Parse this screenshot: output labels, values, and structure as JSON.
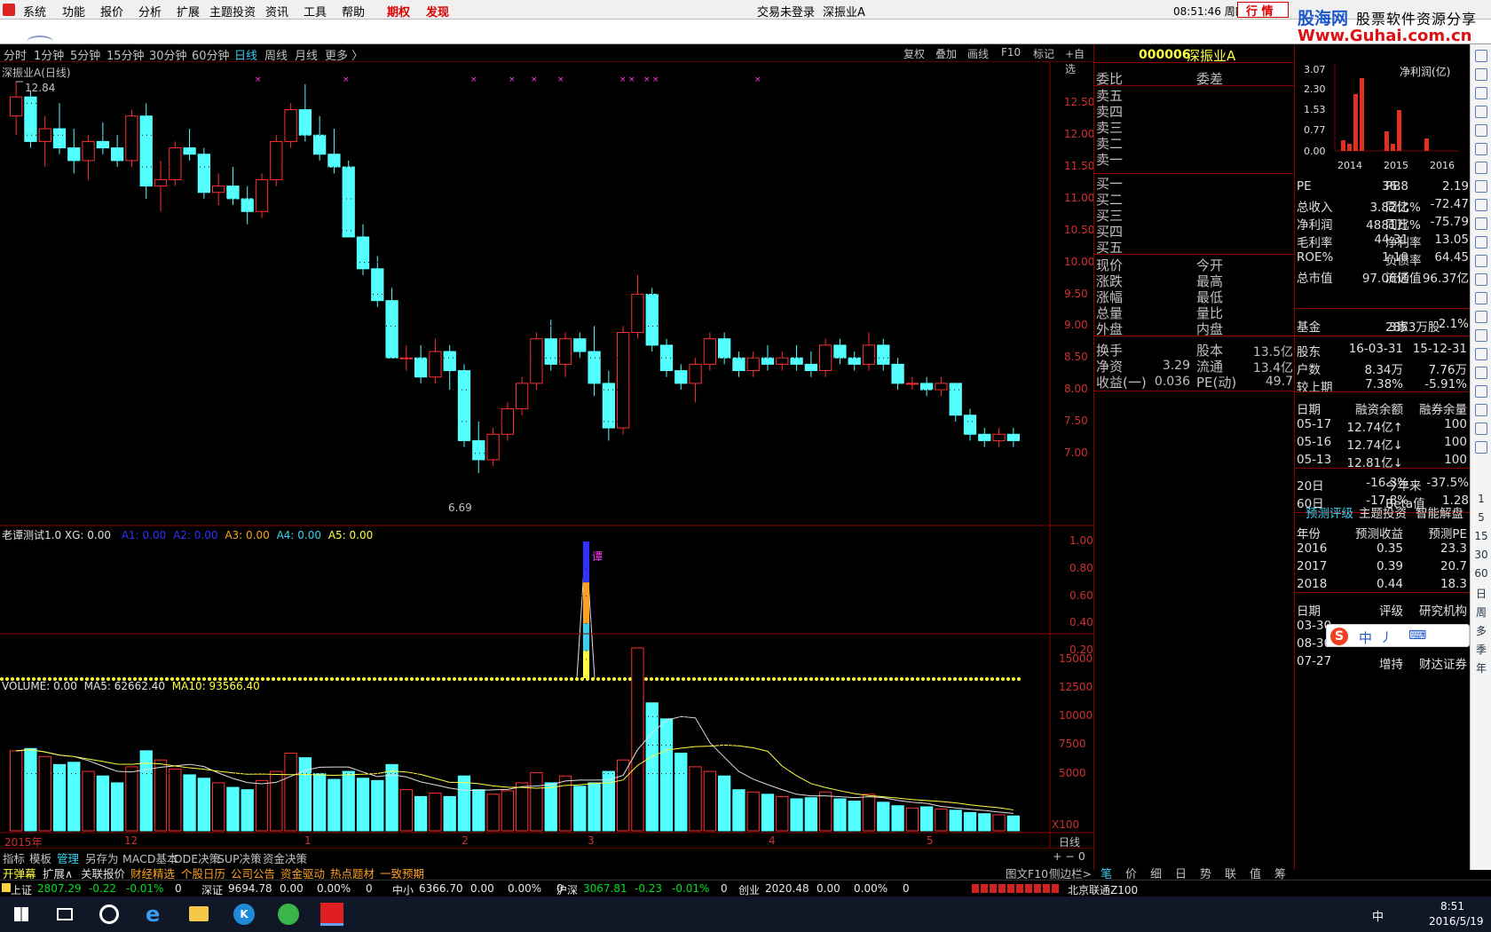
{
  "menu": {
    "items": [
      "系统",
      "功能",
      "报价",
      "分析",
      "扩展",
      "主题投资",
      "资讯",
      "工具",
      "帮助"
    ],
    "options": "期权",
    "discovery": "发现",
    "trade_status": "交易未登录",
    "stock_name": "深振业A",
    "clock": "08:51:46 周四",
    "trade_btn": "行  情"
  },
  "logo": {
    "cn": "股海网",
    "slogan": "股票软件资源分享",
    "url": "Www.Guhai.com.cn"
  },
  "timeframes": [
    "分时",
    "1分钟",
    "5分钟",
    "15分钟",
    "30分钟",
    "60分钟",
    "日线",
    "周线",
    "月线",
    "更多 〉"
  ],
  "chart_tools": [
    "复权",
    "叠加",
    "画线",
    "F10",
    "标记",
    "+自选"
  ],
  "main_chart": {
    "title": "深振业A(日线)",
    "high_label": "12.84",
    "low_label": "6.69",
    "ylabels": [
      "12.50",
      "12.00",
      "11.50",
      "11.00",
      "10.50",
      "10.00",
      "9.50",
      "9.00",
      "8.50",
      "8.00",
      "7.50",
      "7.00"
    ]
  },
  "chart_data": {
    "type": "candlestick",
    "series": [
      {
        "name": "深振业A(日线)",
        "ohlc": [
          [
            12.3,
            12.84,
            12.0,
            12.6
          ],
          [
            12.6,
            12.7,
            11.8,
            11.9
          ],
          [
            11.9,
            12.3,
            11.5,
            12.1
          ],
          [
            12.1,
            12.5,
            11.7,
            11.8
          ],
          [
            11.8,
            12.1,
            11.4,
            11.6
          ],
          [
            11.6,
            12.0,
            11.3,
            11.9
          ],
          [
            11.9,
            12.2,
            11.7,
            11.8
          ],
          [
            11.8,
            12.0,
            11.5,
            11.6
          ],
          [
            11.6,
            12.4,
            11.5,
            12.3
          ],
          [
            12.3,
            12.5,
            11.0,
            11.2
          ],
          [
            11.2,
            11.6,
            10.8,
            11.3
          ],
          [
            11.3,
            11.9,
            11.2,
            11.8
          ],
          [
            11.8,
            12.1,
            11.6,
            11.7
          ],
          [
            11.7,
            11.8,
            11.0,
            11.1
          ],
          [
            11.1,
            11.4,
            10.9,
            11.2
          ],
          [
            11.2,
            11.5,
            10.9,
            11.0
          ],
          [
            11.0,
            11.2,
            10.6,
            10.8
          ],
          [
            10.8,
            11.4,
            10.7,
            11.3
          ],
          [
            11.3,
            12.0,
            11.2,
            11.9
          ],
          [
            11.9,
            12.5,
            11.8,
            12.4
          ],
          [
            12.4,
            12.8,
            11.9,
            12.0
          ],
          [
            12.0,
            12.3,
            11.6,
            11.7
          ],
          [
            11.7,
            12.1,
            11.4,
            11.5
          ],
          [
            11.5,
            11.6,
            10.4,
            10.4
          ],
          [
            10.4,
            10.6,
            9.8,
            9.9
          ],
          [
            9.9,
            10.1,
            9.3,
            9.4
          ],
          [
            9.4,
            9.6,
            8.5,
            8.5
          ],
          [
            8.5,
            8.7,
            8.3,
            8.5
          ],
          [
            8.5,
            8.7,
            8.1,
            8.2
          ],
          [
            8.2,
            8.8,
            8.1,
            8.6
          ],
          [
            8.6,
            8.7,
            8.0,
            8.3
          ],
          [
            8.3,
            8.4,
            7.1,
            7.2
          ],
          [
            7.2,
            7.5,
            6.69,
            6.9
          ],
          [
            6.9,
            7.4,
            6.8,
            7.3
          ],
          [
            7.3,
            7.8,
            7.2,
            7.7
          ],
          [
            7.7,
            8.2,
            7.6,
            8.1
          ],
          [
            8.1,
            8.9,
            8.0,
            8.8
          ],
          [
            8.8,
            9.1,
            8.3,
            8.4
          ],
          [
            8.4,
            8.9,
            8.2,
            8.8
          ],
          [
            8.8,
            8.9,
            8.5,
            8.6
          ],
          [
            8.6,
            9.0,
            7.9,
            8.1
          ],
          [
            8.1,
            8.3,
            7.2,
            7.4
          ],
          [
            7.4,
            9.0,
            7.3,
            8.9
          ],
          [
            8.9,
            9.8,
            8.8,
            9.5
          ],
          [
            9.5,
            9.6,
            8.6,
            8.7
          ],
          [
            8.7,
            8.8,
            8.2,
            8.3
          ],
          [
            8.3,
            8.4,
            8.0,
            8.1
          ],
          [
            8.1,
            8.5,
            7.8,
            8.4
          ],
          [
            8.4,
            8.9,
            8.3,
            8.8
          ],
          [
            8.8,
            8.9,
            8.4,
            8.5
          ],
          [
            8.5,
            8.6,
            8.2,
            8.3
          ],
          [
            8.3,
            8.6,
            8.2,
            8.5
          ],
          [
            8.5,
            8.7,
            8.3,
            8.4
          ],
          [
            8.4,
            8.6,
            8.3,
            8.5
          ],
          [
            8.5,
            8.7,
            8.3,
            8.4
          ],
          [
            8.4,
            8.6,
            8.2,
            8.3
          ],
          [
            8.3,
            8.8,
            8.2,
            8.7
          ],
          [
            8.7,
            8.8,
            8.4,
            8.5
          ],
          [
            8.5,
            8.6,
            8.3,
            8.4
          ],
          [
            8.4,
            8.9,
            8.3,
            8.7
          ],
          [
            8.7,
            8.8,
            8.3,
            8.4
          ],
          [
            8.4,
            8.5,
            8.0,
            8.1
          ],
          [
            8.1,
            8.2,
            8.0,
            8.1
          ],
          [
            8.1,
            8.2,
            7.9,
            8.0
          ],
          [
            8.0,
            8.2,
            7.9,
            8.1
          ],
          [
            8.1,
            8.1,
            7.5,
            7.6
          ],
          [
            7.6,
            7.7,
            7.2,
            7.3
          ],
          [
            7.3,
            7.4,
            7.1,
            7.2
          ],
          [
            7.2,
            7.4,
            7.1,
            7.3
          ],
          [
            7.3,
            7.4,
            7.1,
            7.2
          ]
        ]
      }
    ]
  },
  "ind1": {
    "title": "老谭测试1.0 XG: 0.00",
    "a1": "A1: 0.00",
    "a2": "A2: 0.00",
    "a3": "A3: 0.00",
    "a4": "A4: 0.00",
    "a5": "A5: 0.00",
    "mark": "谭",
    "ylabels": [
      "1.00",
      "0.80",
      "0.60",
      "0.40",
      "0.20"
    ]
  },
  "vol": {
    "title": "VOLUME: 0.00",
    "ma5": "MA5: 62662.40",
    "ma10": "MA10: 93566.40",
    "ylabels": [
      "15000",
      "12500",
      "10000",
      "7500",
      "5000"
    ],
    "unit": "X100"
  },
  "xaxis": {
    "year": "2015年",
    "months": [
      "12",
      "1",
      "2",
      "3",
      "4",
      "5"
    ],
    "period": "日线"
  },
  "order": {
    "code": "000006",
    "name": "深振业A",
    "h1": "委比",
    "h2": "委差",
    "sells": [
      "卖五",
      "卖四",
      "卖三",
      "卖二",
      "卖一"
    ],
    "buys": [
      "买一",
      "买二",
      "买三",
      "买四",
      "买五"
    ],
    "left": [
      "现价",
      "涨跌",
      "涨幅",
      "总量",
      "外盘"
    ],
    "right": [
      "今开",
      "最高",
      "最低",
      "量比",
      "内盘"
    ],
    "turn": "换手",
    "turn_v": "",
    "cap": "股本",
    "cap_v": "13.5亿",
    "na": "净资",
    "na_v": "3.29",
    "flow": "流通",
    "flow_v": "13.4亿",
    "eps": "收益(一)",
    "eps_v": "0.036",
    "pe": "PE(动)",
    "pe_v": "49.7"
  },
  "panel_tabs": [
    "笔",
    "价",
    "细",
    "日",
    "势",
    "联",
    "值",
    "筹"
  ],
  "f10": {
    "chart_label": "净利润(亿)",
    "yvals": [
      "3.07",
      "2.30",
      "1.53",
      "0.77",
      "0.00"
    ],
    "years": [
      "2014",
      "2015",
      "2016"
    ],
    "rows1": [
      [
        "PE",
        "36.8",
        "PB",
        "2.19"
      ],
      [
        "总收入",
        "3.82亿",
        "同比%",
        "-72.47"
      ],
      [
        "净利润",
        "4881万",
        "同比%",
        "-75.79"
      ],
      [
        "毛利率",
        "44.31",
        "净利率",
        "13.05"
      ],
      [
        "ROE%",
        "1.10",
        "负债率",
        "64.45"
      ],
      [
        "总市值",
        "97.06亿",
        "流通值",
        "96.37亿"
      ]
    ],
    "fund": [
      "基金",
      "3家",
      "2853万股",
      "2.1%"
    ],
    "holders": [
      [
        "股东",
        "16-03-31",
        "15-12-31"
      ],
      [
        "户数",
        "8.34万",
        "7.76万"
      ],
      [
        "较上期",
        "7.38%",
        "-5.91%"
      ]
    ],
    "margin_head": [
      "日期",
      "融资余额",
      "融券余量"
    ],
    "margin": [
      [
        "05-17",
        "12.74亿↑",
        "100"
      ],
      [
        "05-16",
        "12.74亿↓",
        "100"
      ],
      [
        "05-13",
        "12.81亿↓",
        "100"
      ]
    ],
    "perf": [
      [
        "20日",
        "-16.3%",
        "今年来",
        "-37.5%"
      ],
      [
        "60日",
        "-17.8%",
        "Beta值",
        "1.28"
      ]
    ],
    "ftabs": [
      "预测评级",
      "主题投资",
      "智能解盘"
    ],
    "fhead": [
      "年份",
      "预测收益",
      "预测PE"
    ],
    "frows": [
      [
        "2016",
        "0.35",
        "23.3"
      ],
      [
        "2017",
        "0.39",
        "20.7"
      ],
      [
        "2018",
        "0.44",
        "18.3"
      ]
    ],
    "rhead": [
      "日期",
      "评级",
      "研究机构"
    ],
    "rrows": [
      [
        "03-30",
        "",
        ""
      ],
      [
        "08-30",
        "",
        ""
      ],
      [
        "07-27",
        "增持",
        "财达证券"
      ]
    ],
    "ime": [
      "中",
      "丿",
      "⌨"
    ]
  },
  "rtool": [
    "1",
    "5",
    "15",
    "30",
    "60",
    "日",
    "周",
    "多",
    "季",
    "年"
  ],
  "bottabs1": [
    "指标",
    "模板",
    "管理",
    "另存为",
    "MACD基本",
    "DDE决策",
    "SUP决策",
    "资金决策"
  ],
  "bottabs2": [
    "开弹幕",
    "扩展∧",
    "关联报价",
    "财经精选",
    "个股日历",
    "公司公告",
    "资金驱动",
    "热点题材",
    "一致预期"
  ],
  "bot_right": [
    "图文F10",
    "侧边栏>"
  ],
  "status": [
    {
      "n": "上证",
      "v": "2807.29",
      "c": "-0.22",
      "p": "-0.01%",
      "a": "0"
    },
    {
      "n": "深证",
      "v": "9694.78",
      "c": "0.00",
      "p": "0.00%",
      "a": "0"
    },
    {
      "n": "中小",
      "v": "6366.70",
      "c": "0.00",
      "p": "0.00%",
      "a": "0"
    },
    {
      "n": "沪深",
      "v": "3067.81",
      "c": "-0.23",
      "p": "-0.01%",
      "a": "0"
    },
    {
      "n": "创业",
      "v": "2020.48",
      "c": "0.00",
      "p": "0.00%",
      "a": "0"
    }
  ],
  "status_right": "北京联通Z100",
  "taskbar": {
    "time": "8:51",
    "date": "2016/5/19",
    "lang": "中"
  }
}
